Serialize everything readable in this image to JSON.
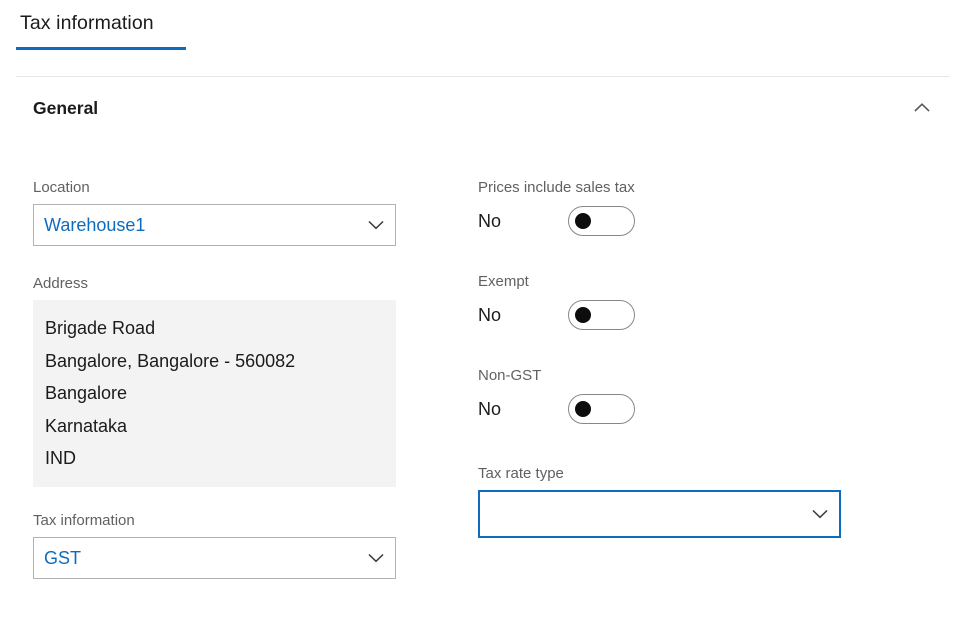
{
  "tabs": [
    {
      "label": "Tax information",
      "selected": true
    }
  ],
  "section": {
    "title": "General",
    "collapse_icon": "chevron-up-icon",
    "expanded": true
  },
  "colors": {
    "accent": "#0f6cbd",
    "label_text": "#616161",
    "body_text": "#1b1b1b",
    "field_border": "#b3b3b3",
    "readonly_bg": "#f3f3f3",
    "divider": "#e6e6e6",
    "toggle_border": "#8a8886",
    "toggle_knob": "#0d0d0d"
  },
  "left_column": {
    "location": {
      "label": "Location",
      "value": "Warehouse1",
      "placeholder": "",
      "chevron_icon": "chevron-down-icon"
    },
    "address": {
      "label": "Address",
      "lines": [
        "Brigade Road",
        "Bangalore, Bangalore - 560082",
        "Bangalore",
        "Karnataka",
        "IND"
      ]
    },
    "tax_information": {
      "label": "Tax information",
      "value": "GST",
      "placeholder": "",
      "chevron_icon": "chevron-down-icon"
    }
  },
  "right_column": {
    "prices_include_sales_tax": {
      "label": "Prices include sales tax",
      "state": "No",
      "on": false
    },
    "exempt": {
      "label": "Exempt",
      "state": "No",
      "on": false
    },
    "non_gst": {
      "label": "Non-GST",
      "state": "No",
      "on": false
    },
    "tax_rate_type": {
      "label": "Tax rate type",
      "value": "",
      "placeholder": "",
      "focused": true,
      "chevron_icon": "chevron-down-icon"
    }
  }
}
